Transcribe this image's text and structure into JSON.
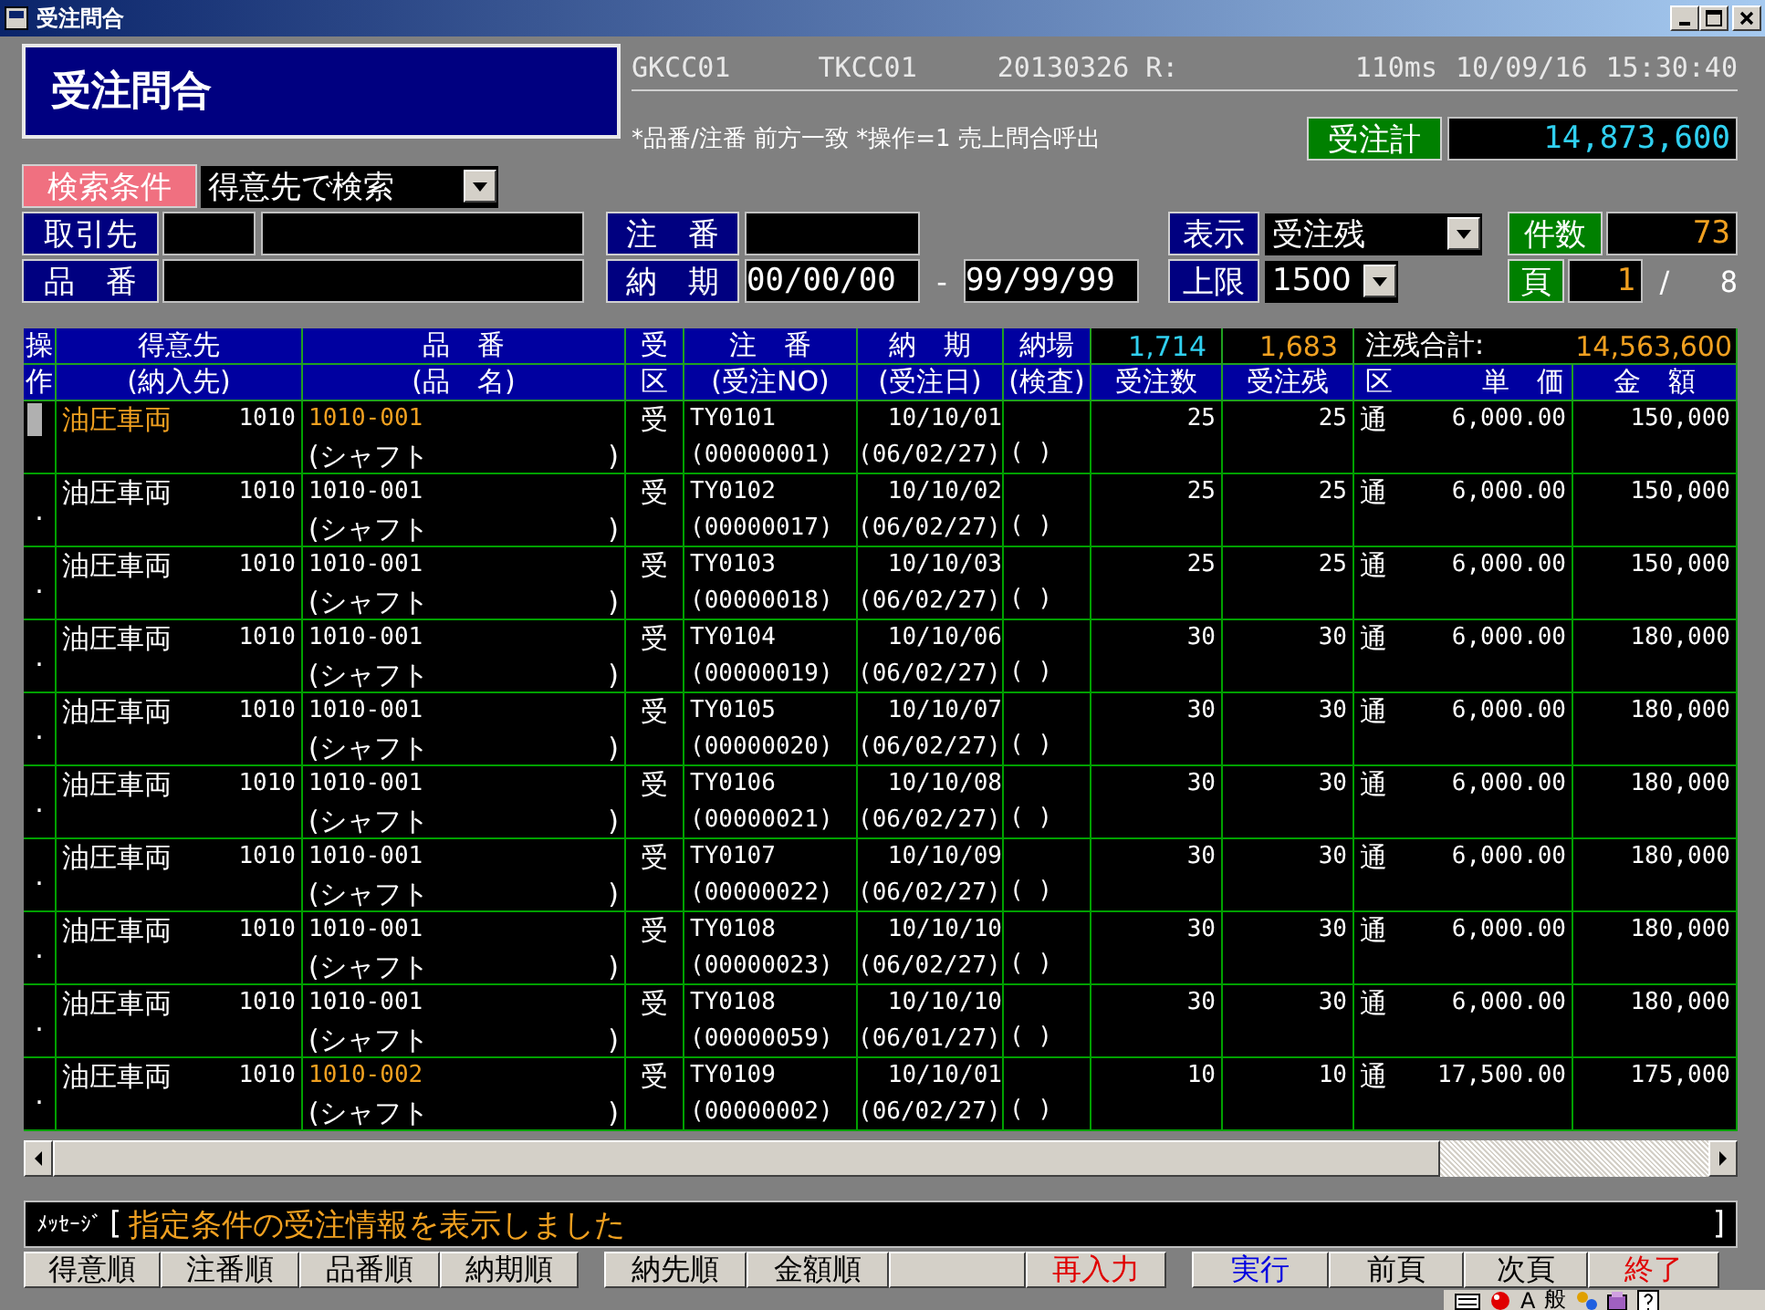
{
  "window": {
    "title": "受注問合"
  },
  "header": {
    "screen_title": "受注問合",
    "info": [
      "GKCC01",
      "TKCC01",
      "20130326 R:",
      "110ms",
      "10/09/16",
      "15:30:40"
    ],
    "hint": "*品番/注番 前方一致 *操作=1 売上問合呼出",
    "total_label": "受注計",
    "total_value": "14,873,600"
  },
  "search": {
    "condition_label": "検索条件",
    "condition_value": "得意先で検索",
    "customer_label": "取引先",
    "item_label": "品　番",
    "order_label": "注　番",
    "due_label": "納　期",
    "due_from": "00/00/00",
    "due_sep": "-",
    "due_to": "99/99/99",
    "display_label": "表示",
    "display_value": "受注残",
    "limit_label": "上限",
    "limit_value": "1500",
    "count_label": "件数",
    "count_value": "73",
    "page_label": "頁",
    "page_value": "1",
    "page_sep": "/",
    "page_total": "8"
  },
  "table": {
    "header_top": [
      "操",
      "得意先",
      "品　番",
      "受",
      "注　番",
      "納　期",
      "納場"
    ],
    "qty_total": "1,714",
    "remain_total": "1,683",
    "balance_label": "注残合計:",
    "balance_total": "14,563,600",
    "header_bottom": [
      "作",
      "(納入先)",
      "(品　名)",
      "区",
      "(受注NO)",
      "(受注日)",
      "(検査)",
      "受注数",
      "受注残",
      "区",
      "単　価",
      "金　額"
    ],
    "rows": [
      {
        "selected": true,
        "customer": "油圧車両",
        "customer_highlight": true,
        "code": "1010",
        "item_no": "1010-001",
        "item_highlight": true,
        "item_name": "(シャフト",
        "item_name_end": ")",
        "kubun": "受",
        "order_no": "TY0101",
        "order_sub": "(00000001)",
        "due": "10/10/01",
        "order_date": "(06/02/27)",
        "place": "(  )",
        "qty": "25",
        "remain": "25",
        "price_kind": "通",
        "price": "6,000.00",
        "amount": "150,000"
      },
      {
        "selected": false,
        "op": ".",
        "customer": "油圧車両",
        "customer_highlight": false,
        "code": "1010",
        "item_no": "1010-001",
        "item_highlight": false,
        "item_name": "(シャフト",
        "item_name_end": ")",
        "kubun": "受",
        "order_no": "TY0102",
        "order_sub": "(00000017)",
        "due": "10/10/02",
        "order_date": "(06/02/27)",
        "place": "(  )",
        "qty": "25",
        "remain": "25",
        "price_kind": "通",
        "price": "6,000.00",
        "amount": "150,000"
      },
      {
        "selected": false,
        "op": ".",
        "customer": "油圧車両",
        "customer_highlight": false,
        "code": "1010",
        "item_no": "1010-001",
        "item_highlight": false,
        "item_name": "(シャフト",
        "item_name_end": ")",
        "kubun": "受",
        "order_no": "TY0103",
        "order_sub": "(00000018)",
        "due": "10/10/03",
        "order_date": "(06/02/27)",
        "place": "(  )",
        "qty": "25",
        "remain": "25",
        "price_kind": "通",
        "price": "6,000.00",
        "amount": "150,000"
      },
      {
        "selected": false,
        "op": ".",
        "customer": "油圧車両",
        "customer_highlight": false,
        "code": "1010",
        "item_no": "1010-001",
        "item_highlight": false,
        "item_name": "(シャフト",
        "item_name_end": ")",
        "kubun": "受",
        "order_no": "TY0104",
        "order_sub": "(00000019)",
        "due": "10/10/06",
        "order_date": "(06/02/27)",
        "place": "(  )",
        "qty": "30",
        "remain": "30",
        "price_kind": "通",
        "price": "6,000.00",
        "amount": "180,000"
      },
      {
        "selected": false,
        "op": ".",
        "customer": "油圧車両",
        "customer_highlight": false,
        "code": "1010",
        "item_no": "1010-001",
        "item_highlight": false,
        "item_name": "(シャフト",
        "item_name_end": ")",
        "kubun": "受",
        "order_no": "TY0105",
        "order_sub": "(00000020)",
        "due": "10/10/07",
        "order_date": "(06/02/27)",
        "place": "(  )",
        "qty": "30",
        "remain": "30",
        "price_kind": "通",
        "price": "6,000.00",
        "amount": "180,000"
      },
      {
        "selected": false,
        "op": ".",
        "customer": "油圧車両",
        "customer_highlight": false,
        "code": "1010",
        "item_no": "1010-001",
        "item_highlight": false,
        "item_name": "(シャフト",
        "item_name_end": ")",
        "kubun": "受",
        "order_no": "TY0106",
        "order_sub": "(00000021)",
        "due": "10/10/08",
        "order_date": "(06/02/27)",
        "place": "(  )",
        "qty": "30",
        "remain": "30",
        "price_kind": "通",
        "price": "6,000.00",
        "amount": "180,000"
      },
      {
        "selected": false,
        "op": ".",
        "customer": "油圧車両",
        "customer_highlight": false,
        "code": "1010",
        "item_no": "1010-001",
        "item_highlight": false,
        "item_name": "(シャフト",
        "item_name_end": ")",
        "kubun": "受",
        "order_no": "TY0107",
        "order_sub": "(00000022)",
        "due": "10/10/09",
        "order_date": "(06/02/27)",
        "place": "(  )",
        "qty": "30",
        "remain": "30",
        "price_kind": "通",
        "price": "6,000.00",
        "amount": "180,000"
      },
      {
        "selected": false,
        "op": ".",
        "customer": "油圧車両",
        "customer_highlight": false,
        "code": "1010",
        "item_no": "1010-001",
        "item_highlight": false,
        "item_name": "(シャフト",
        "item_name_end": ")",
        "kubun": "受",
        "order_no": "TY0108",
        "order_sub": "(00000023)",
        "due": "10/10/10",
        "order_date": "(06/02/27)",
        "place": "(  )",
        "qty": "30",
        "remain": "30",
        "price_kind": "通",
        "price": "6,000.00",
        "amount": "180,000"
      },
      {
        "selected": false,
        "op": ".",
        "customer": "油圧車両",
        "customer_highlight": false,
        "code": "1010",
        "item_no": "1010-001",
        "item_highlight": false,
        "item_name": "(シャフト",
        "item_name_end": ")",
        "kubun": "受",
        "order_no": "TY0108",
        "order_sub": "(00000059)",
        "due": "10/10/10",
        "order_date": "(06/01/27)",
        "place": "(  )",
        "qty": "30",
        "remain": "30",
        "price_kind": "通",
        "price": "6,000.00",
        "amount": "180,000"
      },
      {
        "selected": false,
        "op": ".",
        "customer": "油圧車両",
        "customer_highlight": false,
        "code": "1010",
        "item_no": "1010-002",
        "item_highlight": true,
        "item_name": "(シャフト",
        "item_name_end": ")",
        "kubun": "受",
        "order_no": "TY0109",
        "order_sub": "(00000002)",
        "due": "10/10/01",
        "order_date": "(06/02/27)",
        "place": "(  )",
        "qty": "10",
        "remain": "10",
        "price_kind": "通",
        "price": "17,500.00",
        "amount": "175,000"
      }
    ]
  },
  "message": {
    "label": "ﾒｯｾｰｼﾞ",
    "open": "[",
    "text": "指定条件の受注情報を表示しました",
    "close": "]"
  },
  "buttons": [
    {
      "label": "得意順",
      "kind": "sort",
      "gap_before": false
    },
    {
      "label": "注番順",
      "kind": "sort",
      "gap_before": false
    },
    {
      "label": "品番順",
      "kind": "sort",
      "gap_before": false
    },
    {
      "label": "納期順",
      "kind": "sort",
      "gap_before": false
    },
    {
      "label": "納先順",
      "kind": "sort",
      "gap_before": true
    },
    {
      "label": "金額順",
      "kind": "sort",
      "gap_before": false
    },
    {
      "kind": "blank",
      "gap_before": false
    },
    {
      "label": "再入力",
      "kind": "reset",
      "gap_before": false
    },
    {
      "label": "実行",
      "kind": "run",
      "gap_before": true
    },
    {
      "label": "前頁",
      "kind": "nav",
      "gap_before": false
    },
    {
      "label": "次頁",
      "kind": "nav",
      "gap_before": false
    },
    {
      "label": "終了",
      "kind": "exit",
      "gap_before": false
    }
  ],
  "tray": {
    "ime": "A",
    "mode": "般"
  }
}
